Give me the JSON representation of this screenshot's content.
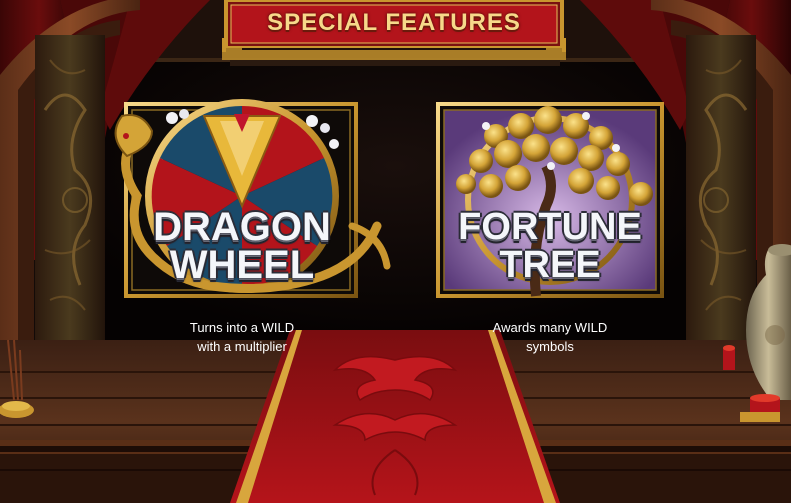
{
  "header": {
    "title": "SPECIAL FEATURES"
  },
  "features": [
    {
      "title_line1": "DRAGON",
      "title_line2": "WHEEL",
      "desc_line1": "Turns into a WILD",
      "desc_line2": "with a multiplier",
      "icon": "dragon-wheel-icon"
    },
    {
      "title_line1": "FORTUNE",
      "title_line2": "TREE",
      "desc_line1": "Awards many WILD",
      "desc_line2": "symbols",
      "icon": "fortune-tree-icon"
    }
  ],
  "colors": {
    "gold": "#d4a437",
    "gold_light": "#f7d98a",
    "red": "#b3141b",
    "dark_red": "#5a0a0a",
    "wood": "#6b3d22",
    "text_white": "#ffffff"
  }
}
